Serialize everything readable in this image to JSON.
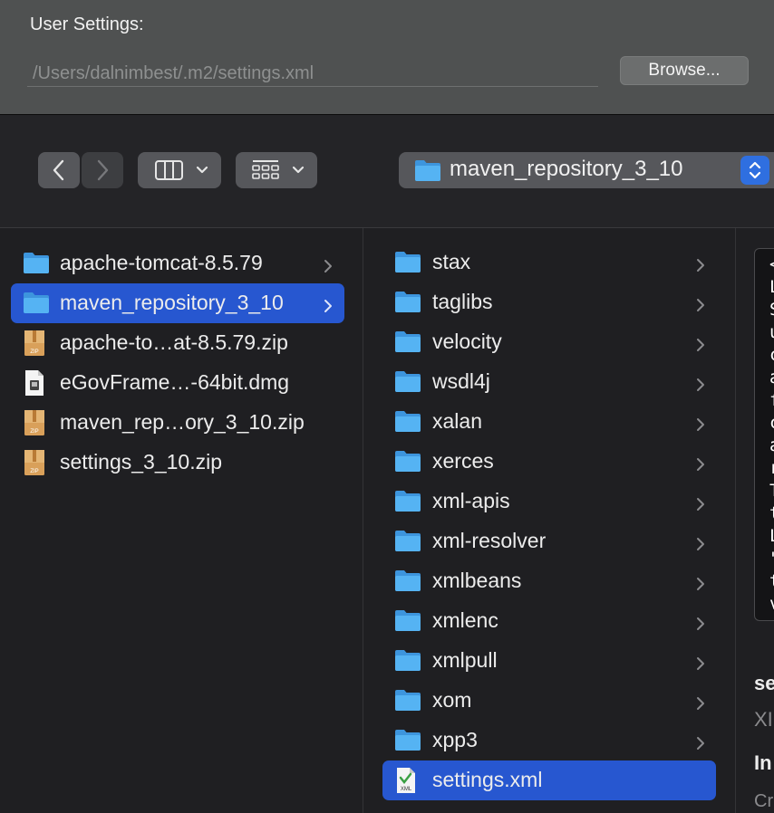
{
  "preferences": {
    "user_settings_label": "User Settings:",
    "settings_path": "/Users/dalnimbest/.m2/settings.xml",
    "browse_label": "Browse..."
  },
  "toolbar": {
    "location_label": "maven_repository_3_10"
  },
  "column1": {
    "items": [
      {
        "label": "apache-tomcat-8.5.79",
        "type": "folder",
        "has_children": true,
        "selected": false
      },
      {
        "label": "maven_repository_3_10",
        "type": "folder",
        "has_children": true,
        "selected": true
      },
      {
        "label": "apache-to…at-8.5.79.zip",
        "type": "zip",
        "has_children": false,
        "selected": false
      },
      {
        "label": "eGovFrame…-64bit.dmg",
        "type": "dmg",
        "has_children": false,
        "selected": false
      },
      {
        "label": "maven_rep…ory_3_10.zip",
        "type": "zip",
        "has_children": false,
        "selected": false
      },
      {
        "label": "settings_3_10.zip",
        "type": "zip",
        "has_children": false,
        "selected": false
      }
    ]
  },
  "column2": {
    "items": [
      {
        "label": "stax",
        "type": "folder"
      },
      {
        "label": "taglibs",
        "type": "folder"
      },
      {
        "label": "velocity",
        "type": "folder"
      },
      {
        "label": "wsdl4j",
        "type": "folder"
      },
      {
        "label": "xalan",
        "type": "folder"
      },
      {
        "label": "xerces",
        "type": "folder"
      },
      {
        "label": "xml-apis",
        "type": "folder"
      },
      {
        "label": "xml-resolver",
        "type": "folder"
      },
      {
        "label": "xmlbeans",
        "type": "folder"
      },
      {
        "label": "xmlenc",
        "type": "folder"
      },
      {
        "label": "xmlpull",
        "type": "folder"
      },
      {
        "label": "xom",
        "type": "folder"
      },
      {
        "label": "xpp3",
        "type": "folder"
      },
      {
        "label": "settings.xml",
        "type": "xml",
        "selected": true
      }
    ]
  },
  "preview": {
    "text_lines": [
      "<",
      "L",
      "S",
      "u",
      "c",
      "a",
      "f",
      "c",
      "a",
      "r",
      "T",
      "t",
      "L",
      "\"",
      "t",
      "v"
    ],
    "name_partial": "se",
    "kind_partial": "XI",
    "info_heading_partial": "In",
    "created_partial": "Cr"
  },
  "colors": {
    "selection": "#2757d0",
    "folder": "#4aa8ee",
    "stepper": "#2f6fe0"
  }
}
